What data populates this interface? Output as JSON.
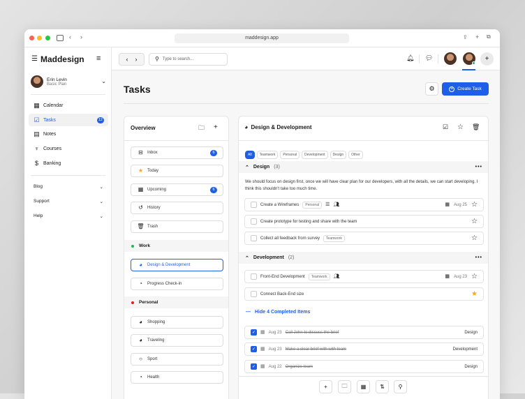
{
  "browser": {
    "url": "maddesign.app"
  },
  "sidebar": {
    "app_name": "Maddesign",
    "user": {
      "name": "Erin Levin",
      "plan": "Basic Plan"
    },
    "nav": [
      {
        "label": "Calendar",
        "icon": "calendar-icon"
      },
      {
        "label": "Tasks",
        "icon": "tasks-icon",
        "badge": "12",
        "active": true
      },
      {
        "label": "Notes",
        "icon": "notes-icon"
      },
      {
        "label": "Courses",
        "icon": "courses-icon"
      },
      {
        "label": "Banking",
        "icon": "banking-icon"
      }
    ],
    "sections": [
      {
        "label": "Blog"
      },
      {
        "label": "Support"
      },
      {
        "label": "Help"
      }
    ]
  },
  "header": {
    "search_placeholder": "Type to search..."
  },
  "page": {
    "title": "Tasks",
    "create_label": "Create Task"
  },
  "overview": {
    "title": "Overview",
    "items": [
      {
        "label": "Inbox",
        "badge": "6",
        "icon": "inbox-icon"
      },
      {
        "label": "Today",
        "icon": "star-icon"
      },
      {
        "label": "Upcoming",
        "badge": "6",
        "icon": "calendar-icon"
      },
      {
        "label": "History",
        "icon": "history-icon"
      },
      {
        "label": "Trash",
        "icon": "trash-icon"
      }
    ],
    "groups": [
      {
        "label": "Work",
        "color": "#1db954",
        "items": [
          {
            "label": "Design & Development",
            "active": true
          },
          {
            "label": "Progress Check-in"
          }
        ]
      },
      {
        "label": "Personal",
        "color": "#e02020",
        "items": [
          {
            "label": "Shopping"
          },
          {
            "label": "Traveling"
          },
          {
            "label": "Sport"
          },
          {
            "label": "Health"
          }
        ]
      }
    ]
  },
  "detail": {
    "title": "Design & Development",
    "filters": [
      "All",
      "Teamwork",
      "Personal",
      "Development",
      "Design",
      "Other"
    ],
    "design": {
      "name": "Design",
      "count": "(3)",
      "description": "We should focus on design first, once we will have clear plan for our developers, with all the details, we can start developing. I think this shouldn't take too much time.",
      "tasks": [
        {
          "title": "Create a Wireframes",
          "tag": "Personal",
          "date": "Aug 25"
        },
        {
          "title": "Create prototype for testing and share with the team"
        },
        {
          "title": "Collect all feedback from survey",
          "tag": "Teamwork"
        }
      ]
    },
    "development": {
      "name": "Development",
      "count": "(2)",
      "tasks": [
        {
          "title": "Front-End Development",
          "tag": "Teamwork",
          "date": "Aug 23"
        },
        {
          "title": "Connect Back-End size",
          "starred": true
        }
      ]
    },
    "completed_toggle": "Hide 4 Completed Items",
    "completed": [
      {
        "date": "Aug 23",
        "title": "Call John to discuss the brief",
        "category": "Design"
      },
      {
        "date": "Aug 23",
        "title": "Make a clear brief with with team",
        "category": "Development"
      },
      {
        "date": "Aug 22",
        "title": "Organize team",
        "category": "Design"
      }
    ]
  },
  "colors": {
    "accent": "#1f5fe8",
    "star": "#f5a623"
  }
}
